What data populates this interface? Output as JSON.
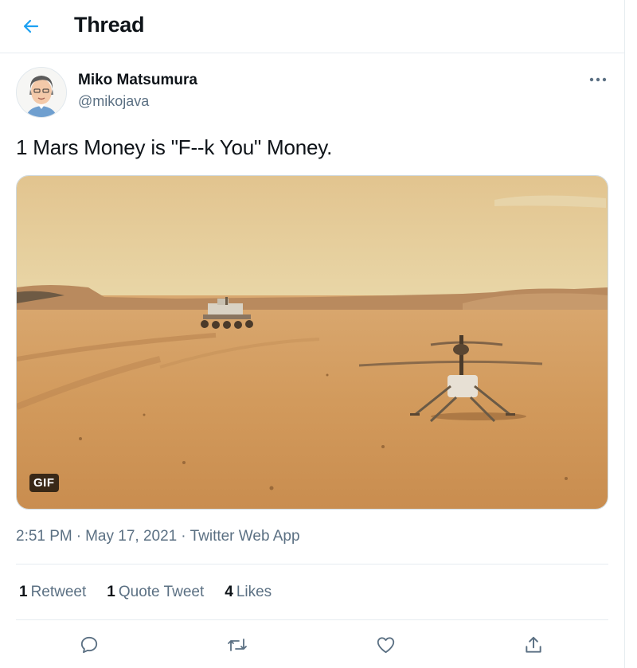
{
  "header": {
    "title": "Thread"
  },
  "author": {
    "name": "Miko Matsumura",
    "handle": "@mikojava"
  },
  "tweet": {
    "text": "1 Mars Money is \"F--k You\" Money.",
    "media_badge": "GIF",
    "time": "2:51 PM",
    "date": "May 17, 2021",
    "source": "Twitter Web App",
    "separator": "·"
  },
  "stats": [
    {
      "count": "1",
      "label": "Retweet"
    },
    {
      "count": "1",
      "label": "Quote Tweet"
    },
    {
      "count": "4",
      "label": "Likes"
    }
  ],
  "icons": {
    "back": "arrow-left-icon",
    "more": "more-horizontal-icon",
    "reply": "reply-icon",
    "retweet": "retweet-icon",
    "like": "heart-icon",
    "share": "share-icon"
  },
  "colors": {
    "accent": "#1da1f2",
    "text": "#0f1419",
    "secondary": "#5b7083",
    "border": "#e6ecf0"
  }
}
